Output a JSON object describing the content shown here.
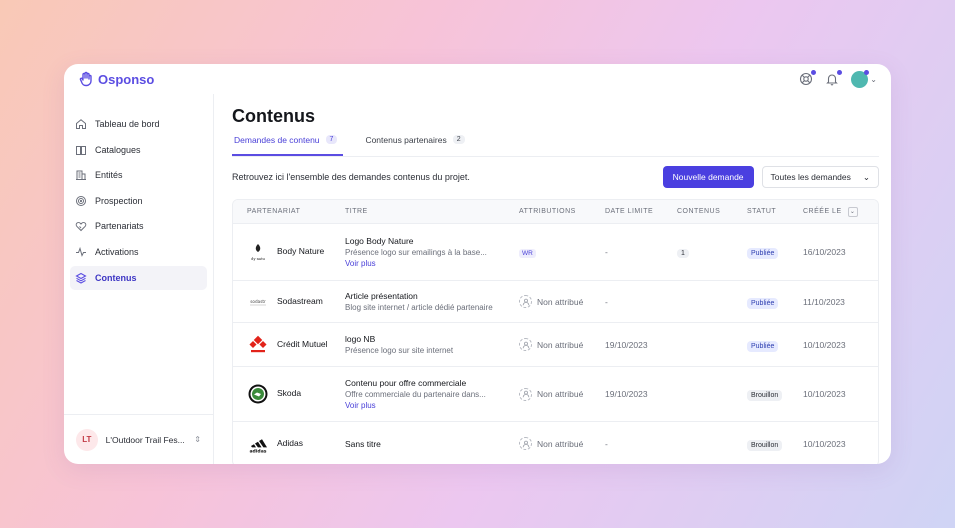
{
  "brand": {
    "name": "Osponso",
    "accent": "#4a3fe0"
  },
  "topbar": {
    "icons": [
      "help-icon",
      "bell-icon",
      "user-avatar"
    ]
  },
  "sidebar": {
    "items": [
      {
        "label": "Tableau de bord",
        "icon": "home-icon"
      },
      {
        "label": "Catalogues",
        "icon": "book-icon"
      },
      {
        "label": "Entités",
        "icon": "building-icon"
      },
      {
        "label": "Prospection",
        "icon": "target-icon"
      },
      {
        "label": "Partenariats",
        "icon": "handshake-icon"
      },
      {
        "label": "Activations",
        "icon": "activity-icon"
      },
      {
        "label": "Contenus",
        "icon": "layers-icon",
        "active": true
      }
    ],
    "org": {
      "initials": "LT",
      "name": "L'Outdoor Trail Fes..."
    }
  },
  "main": {
    "title": "Contenus",
    "tabs": [
      {
        "label": "Demandes de contenu",
        "count": "7",
        "active": true
      },
      {
        "label": "Contenus partenaires",
        "count": "2"
      }
    ],
    "intro": "Retrouvez ici l'ensemble des demandes contenus du projet.",
    "new_button": "Nouvelle demande",
    "filter": "Toutes les demandes",
    "table": {
      "headers": [
        "PARTENARIAT",
        "TITRE",
        "ATTRIBUTIONS",
        "DATE LIMITE",
        "CONTENUS",
        "STATUT",
        "CRÉÉE LE"
      ],
      "rows": [
        {
          "partner": "Body Nature",
          "logo_text": "dy natu",
          "title": "Logo Body Nature",
          "desc": "Présence logo sur emailings à la base...",
          "more": "Voir plus",
          "attribution": "WR",
          "deadline": "-",
          "contents": "1",
          "status": "Publiée",
          "created": "16/10/2023"
        },
        {
          "partner": "Sodastream",
          "logo_text": "sodastr",
          "title": "Article présentation",
          "desc": "Blog site internet / article dédié partenaire",
          "more": "",
          "attribution": "Non attribué",
          "deadline": "-",
          "contents": "",
          "status": "Publiée",
          "created": "11/10/2023"
        },
        {
          "partner": "Crédit Mutuel",
          "logo_text": "",
          "title": "logo NB",
          "desc": "Présence logo sur site internet",
          "more": "",
          "attribution": "Non attribué",
          "deadline": "19/10/2023",
          "contents": "",
          "status": "Publiée",
          "created": "10/10/2023"
        },
        {
          "partner": "Skoda",
          "logo_text": "",
          "title": "Contenu pour offre commerciale",
          "desc": "Offre commerciale du partenaire dans...",
          "more": "Voir plus",
          "attribution": "Non attribué",
          "deadline": "19/10/2023",
          "contents": "",
          "status": "Brouillon",
          "created": "10/10/2023"
        },
        {
          "partner": "Adidas",
          "logo_text": "adidas",
          "title": "Sans titre",
          "desc": "",
          "more": "",
          "attribution": "Non attribué",
          "deadline": "-",
          "contents": "",
          "status": "Brouillon",
          "created": "10/10/2023"
        }
      ]
    }
  }
}
